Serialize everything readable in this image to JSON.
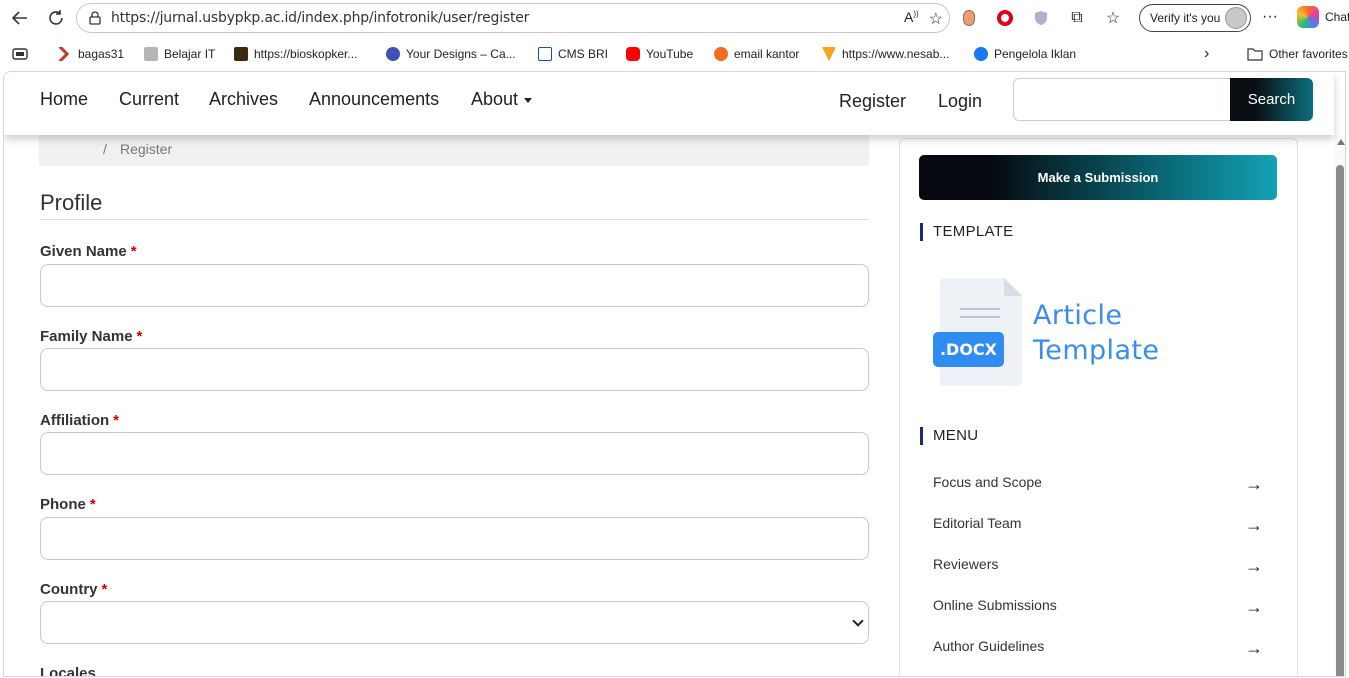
{
  "browser": {
    "url": "https://jurnal.usbypkp.ac.id/index.php/infotronik/user/register",
    "verify_label": "Verify it's you",
    "copilot_label": "Chat",
    "bookmarks": [
      {
        "label": "bagas31",
        "color": "#c0392b"
      },
      {
        "label": "Belajar IT",
        "color": "#8a8a8a"
      },
      {
        "label": "https://bioskopker...",
        "color": "#3b2b12"
      },
      {
        "label": "Your Designs – Ca...",
        "color": "#3f51b5"
      },
      {
        "label": "CMS BRI",
        "color": "#1a4fa0"
      },
      {
        "label": "YouTube",
        "color": "#ff0000"
      },
      {
        "label": "email kantor",
        "color": "#f36b21"
      },
      {
        "label": "https://www.nesab...",
        "color": "#f4a41d"
      },
      {
        "label": "Pengelola Iklan",
        "color": "#1877f2"
      }
    ],
    "other_favorites": "Other favorites"
  },
  "site_nav": {
    "items": [
      "Home",
      "Current",
      "Archives",
      "Announcements",
      "About"
    ],
    "register": "Register",
    "login": "Login",
    "search_button": "Search",
    "search_value": ""
  },
  "breadcrumb": {
    "separator": "/",
    "current": "Register"
  },
  "form": {
    "section_title": "Profile",
    "required_marker": "*",
    "fields": [
      {
        "label": "Given Name",
        "value": ""
      },
      {
        "label": "Family Name",
        "value": ""
      },
      {
        "label": "Affiliation",
        "value": ""
      },
      {
        "label": "Phone",
        "value": ""
      },
      {
        "label": "Country",
        "value": ""
      }
    ],
    "cutoff_label": "Locales"
  },
  "sidebar": {
    "submit_button": "Make a Submission",
    "template_heading": "TEMPLATE",
    "template_badge": ".DOCX",
    "template_line1": "Article",
    "template_line2": "Template",
    "menu_heading": "MENU",
    "menu_items": [
      "Focus and Scope",
      "Editorial Team",
      "Reviewers",
      "Online Submissions",
      "Author Guidelines"
    ]
  },
  "colors": {
    "accent_teal": "#0b6f7d",
    "required_red": "#d00000",
    "template_blue": "#3a8de8",
    "heading_bar": "#1b2a7a"
  }
}
